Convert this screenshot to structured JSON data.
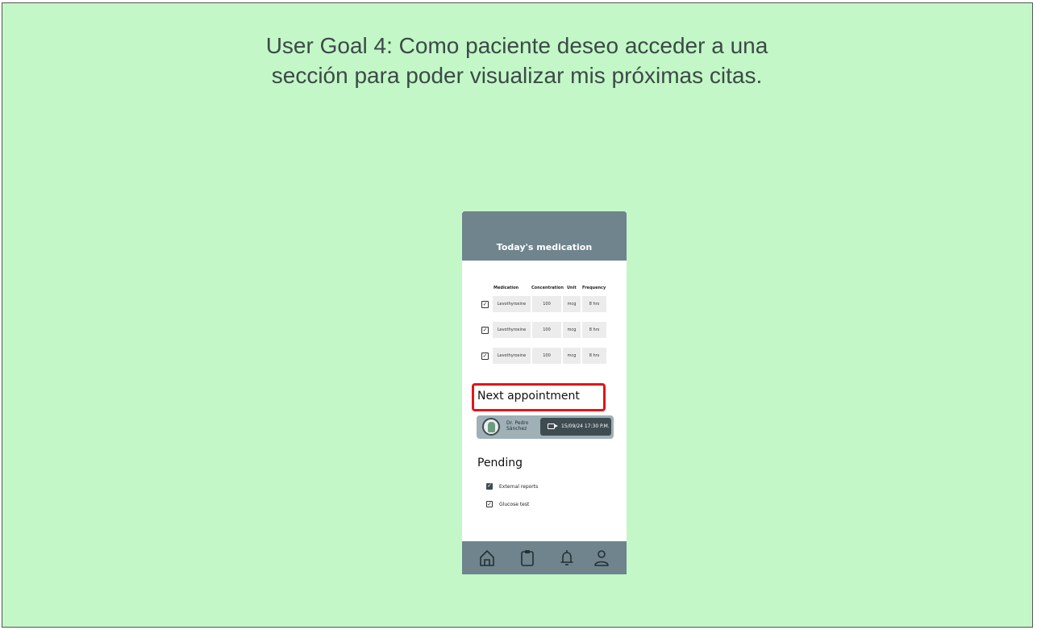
{
  "goal": {
    "line1": "User Goal 4: Como paciente deseo acceder a una",
    "line2": "sección para poder visualizar mis próximas citas."
  },
  "phone": {
    "header_title": "Today's medication",
    "medication": {
      "columns": [
        "Medication",
        "Concentration",
        "Unit",
        "Frequency"
      ],
      "rows": [
        {
          "checked": true,
          "name": "Levothyroxine",
          "concentration": "100",
          "unit": "mcg",
          "frequency": "8 hrs"
        },
        {
          "checked": true,
          "name": "Levothyroxine",
          "concentration": "100",
          "unit": "mcg",
          "frequency": "8 hrs"
        },
        {
          "checked": true,
          "name": "Levothyroxine",
          "concentration": "100",
          "unit": "mcg",
          "frequency": "8 hrs"
        }
      ]
    },
    "next_appointment": {
      "title": "Next appointment",
      "doctor_line1": "Dr. Pedro",
      "doctor_line2": "Sánchez",
      "datetime": "15/09/24 17:30 P.M.",
      "icon": "video-camera-icon"
    },
    "pending": {
      "title": "Pending",
      "items": [
        {
          "label": "External reports",
          "state": "filled"
        },
        {
          "label": "Glucose test",
          "state": "outline"
        }
      ]
    },
    "nav": [
      "home-icon",
      "clipboard-icon",
      "bell-icon",
      "user-icon"
    ]
  },
  "colors": {
    "canvas_bg": "#c3f7c7",
    "phone_header": "#6f848d",
    "highlight": "#e0161b",
    "appt_card": "#9fb0b6",
    "appt_pill": "#3e4c52"
  }
}
